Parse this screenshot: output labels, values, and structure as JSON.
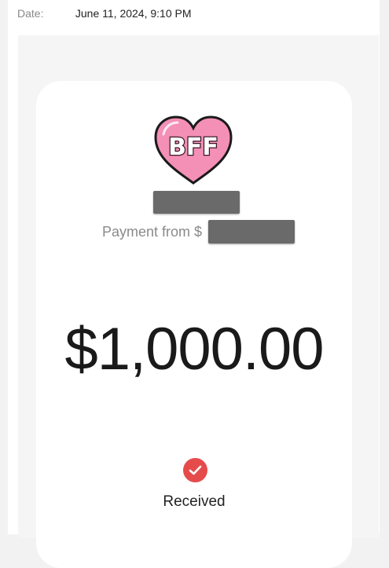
{
  "date": {
    "label": "Date:",
    "value": "June 11, 2024, 9:10 PM"
  },
  "payment": {
    "avatar_icon": "bff-heart-icon",
    "avatar_text": "BFF",
    "from_label": "Payment from $",
    "amount": "$1,000.00",
    "status": "Received",
    "status_icon": "check-circle-icon",
    "status_color": "#e64b4b",
    "avatar_color": "#f48fb6"
  }
}
